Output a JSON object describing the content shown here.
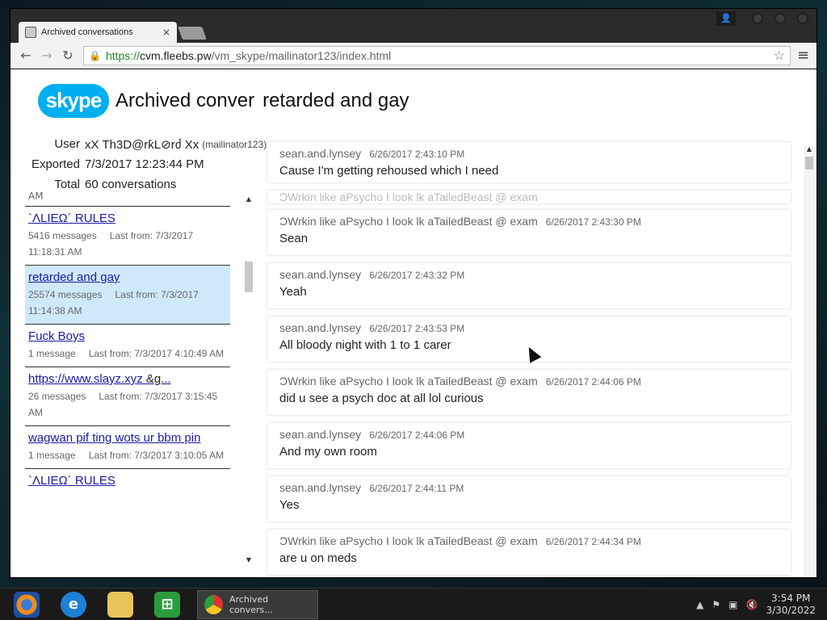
{
  "browser": {
    "tab_title": "Archived conversations",
    "tab_close": "×",
    "url_scheme": "https://",
    "url_host": "cvm.fleebs.pw",
    "url_path": "/vm_skype/mailinator123/index.html"
  },
  "header": {
    "logo": "skype",
    "title_left": "Archived conver",
    "title_right": "retarded and gay"
  },
  "meta": {
    "user_label": "User",
    "user_value": "xX Th3D@rƙL⊘rძ Xx",
    "user_handle": "(mailinator123)",
    "exported_label": "Exported",
    "exported_value": "7/3/2017 12:23:44 PM",
    "total_label": "Total",
    "total_value": "60 conversations"
  },
  "conversations": {
    "partial_top": "AM",
    "items": [
      {
        "name": "`ΛLIΕΩ´ RULES",
        "tail": "",
        "count": "5416 messages",
        "last": "Last from: 7/3/2017 11:18:31 AM"
      },
      {
        "name": "retarded and gay",
        "tail": "",
        "count": "25574 messages",
        "last": "Last from: 7/3/2017 11:14:38 AM"
      },
      {
        "name": "Fuck Boys",
        "tail": "",
        "count": "1 message",
        "last": "Last from: 7/3/2017 4:10:49 AM"
      },
      {
        "name": "https://www.slayz.xyz",
        "tail": " &g...",
        "count": "26 messages",
        "last": "Last from: 7/3/2017 3:15:45 AM"
      },
      {
        "name": "wagwan pif ting wots ur bbm pin",
        "tail": "",
        "count": "1 message",
        "last": "Last from: 7/3/2017 3:10:05 AM"
      },
      {
        "name": "`ΛLIΕΩ´ RULES",
        "tail": "",
        "count": "",
        "last": ""
      }
    ]
  },
  "messages": [
    {
      "sender": "sean.and.lynsey",
      "time": "6/26/2017 2:43:10 PM",
      "text": "Cause I'm getting rehoused which I need"
    },
    {
      "sender": "ƆWrkin like aPsycho I look lk aTailedBeast @ exam",
      "time": "",
      "text": ""
    },
    {
      "sender": "ƆWrkin like aPsycho I look lk aTailedBeast @ exam",
      "time": "6/26/2017 2:43:30 PM",
      "text": "Sean"
    },
    {
      "sender": "sean.and.lynsey",
      "time": "6/26/2017 2:43:32 PM",
      "text": "Yeah"
    },
    {
      "sender": "sean.and.lynsey",
      "time": "6/26/2017 2:43:53 PM",
      "text": "All bloody night with 1 to 1 carer"
    },
    {
      "sender": "ƆWrkin like aPsycho I look lk aTailedBeast @ exam",
      "time": "6/26/2017 2:44:06 PM",
      "text": "did u see a psych doc at all lol curious"
    },
    {
      "sender": "sean.and.lynsey",
      "time": "6/26/2017 2:44:06 PM",
      "text": "And my own room"
    },
    {
      "sender": "sean.and.lynsey",
      "time": "6/26/2017 2:44:11 PM",
      "text": "Yes"
    },
    {
      "sender": "ƆWrkin like aPsycho I look lk aTailedBeast @ exam",
      "time": "6/26/2017 2:44:34 PM",
      "text": "are u on meds"
    }
  ],
  "taskbar": {
    "task_label": "Archived convers...",
    "time": "3:54 PM",
    "date": "3/30/2022"
  },
  "icons": [
    "skype-logo",
    "back-icon",
    "forward-icon",
    "reload-icon",
    "lock-icon",
    "star-icon",
    "menu-icon",
    "cursor-icon",
    "windows-media-icon",
    "ie-icon",
    "explorer-icon",
    "store-icon",
    "chrome-icon",
    "flag-icon",
    "network-icon",
    "volume-icon"
  ],
  "colors": {
    "skype_blue": "#00aff0",
    "selected_bg": "#cfe9fb",
    "link": "#1a1aa6",
    "url_green": "#1b8a1b"
  }
}
